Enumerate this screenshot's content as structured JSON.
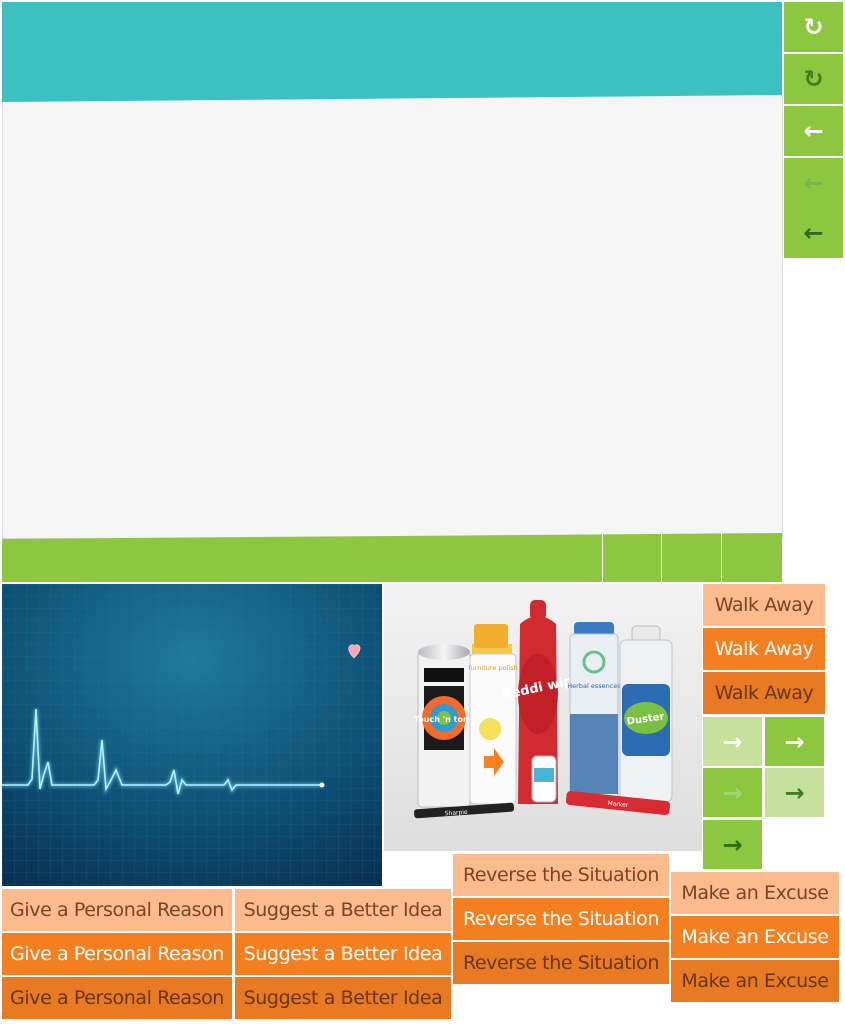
{
  "side_toolbar": {
    "buttons": [
      {
        "glyph": "↻",
        "color": "#ffffff"
      },
      {
        "glyph": "↻",
        "color": "#3f7d20"
      },
      {
        "glyph": "←",
        "color": "#ffffff"
      },
      {
        "glyph": "←",
        "color": "#7fb342"
      },
      {
        "glyph": "←",
        "color": "#2f6e17"
      }
    ]
  },
  "tiles": {
    "walk_away": [
      "Walk Away",
      "Walk Away",
      "Walk Away"
    ],
    "personal_reason": [
      "Give a Personal Reason",
      "Give a Personal Reason",
      "Give a Personal Reason"
    ],
    "better_idea": [
      "Suggest a Better Idea",
      "Suggest a Better Idea",
      "Suggest a Better Idea"
    ],
    "reverse": [
      "Reverse the Situation",
      "Reverse the Situation",
      "Reverse the Situation"
    ],
    "excuse": [
      "Make an Excuse",
      "Make an Excuse",
      "Make an Excuse"
    ]
  },
  "arrow_glyph": "→",
  "product_labels": {
    "touch_n_tone": "Touch 'n tone",
    "furniture_polish": "furniture polish",
    "reddi_wip": "Reddi wip",
    "herbal_essences": "Herbal essences",
    "duster": "Duster",
    "sharpie": "Sharpie",
    "marker": "Marker"
  },
  "colors": {
    "teal": "#3cc0c1",
    "green": "#8dc63f",
    "light_green": "#c5e19b",
    "peach": "#fbbb8c",
    "orange": "#f47f20"
  }
}
